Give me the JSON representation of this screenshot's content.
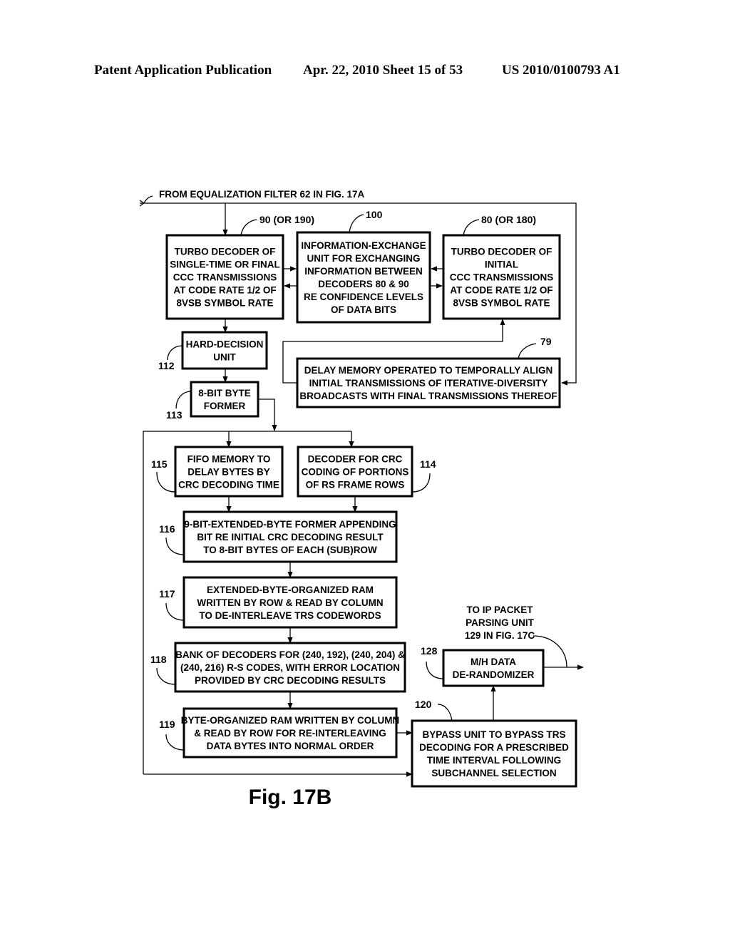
{
  "header": {
    "publication": "Patent Application Publication",
    "date_sheet": "Apr. 22, 2010  Sheet 15 of 53",
    "patent_number": "US 2010/0100793 A1"
  },
  "input_label": "FROM EQUALIZATION FILTER 62 IN FIG. 17A",
  "output_label": [
    "TO IP PACKET",
    "PARSING UNIT",
    "129 IN FIG. 17C"
  ],
  "figure_caption": "Fig. 17B",
  "blocks": {
    "b90": {
      "ref": "90 (OR 190)",
      "lines": [
        "TURBO DECODER OF",
        "SINGLE-TIME OR FINAL",
        "CCC TRANSMISSIONS",
        "AT CODE RATE 1/2 OF",
        "8VSB SYMBOL RATE"
      ]
    },
    "b100": {
      "ref": "100",
      "lines": [
        "INFORMATION-EXCHANGE",
        "UNIT FOR EXCHANGING",
        "INFORMATION BETWEEN",
        "DECODERS  80 & 90",
        "RE CONFIDENCE LEVELS",
        "OF DATA BITS"
      ]
    },
    "b80": {
      "ref": "80 (OR 180)",
      "lines": [
        "TURBO DECODER OF",
        "INITIAL",
        "CCC TRANSMISSIONS",
        "AT CODE RATE 1/2 OF",
        "8VSB SYMBOL RATE"
      ]
    },
    "b112": {
      "ref": "112",
      "lines": [
        "HARD-DECISION",
        "UNIT"
      ]
    },
    "b79": {
      "ref": "79",
      "lines": [
        "DELAY MEMORY OPERATED TO TEMPORALLY ALIGN",
        "INITIAL TRANSMISSIONS OF ITERATIVE-DIVERSITY",
        "BROADCASTS WITH FINAL TRANSMISSIONS THEREOF"
      ]
    },
    "b113": {
      "ref": "113",
      "lines": [
        "8-BIT BYTE",
        "FORMER"
      ]
    },
    "b115": {
      "ref": "115",
      "lines": [
        "FIFO MEMORY TO",
        "DELAY BYTES BY",
        "CRC DECODING TIME"
      ]
    },
    "b114": {
      "ref": "114",
      "lines": [
        "DECODER FOR CRC",
        "CODING OF PORTIONS",
        "OF RS FRAME ROWS"
      ]
    },
    "b116": {
      "ref": "116",
      "lines": [
        "9-BIT-EXTENDED-BYTE FORMER APPENDING",
        "BIT RE INITIAL CRC DECODING RESULT",
        "TO 8-BIT BYTES OF EACH (SUB)ROW"
      ]
    },
    "b117": {
      "ref": "117",
      "lines": [
        "EXTENDED-BYTE-ORGANIZED RAM",
        "WRITTEN BY ROW & READ BY COLUMN",
        "TO DE-INTERLEAVE TRS CODEWORDS"
      ]
    },
    "b118": {
      "ref": "118",
      "lines": [
        "BANK OF DECODERS FOR (240, 192), (240, 204) &",
        "(240, 216) R-S CODES, WITH ERROR LOCATION",
        "PROVIDED BY CRC DECODING RESULTS"
      ]
    },
    "b119": {
      "ref": "119",
      "lines": [
        "BYTE-ORGANIZED RAM WRITTEN BY COLUMN",
        "& READ BY ROW FOR RE-INTERLEAVING",
        "DATA BYTES INTO NORMAL ORDER"
      ]
    },
    "b120": {
      "ref": "120",
      "lines": [
        "BYPASS UNIT TO BYPASS TRS",
        "DECODING FOR A PRESCRIBED",
        "TIME INTERVAL FOLLOWING",
        "SUBCHANNEL SELECTION"
      ]
    },
    "b128": {
      "ref": "128",
      "lines": [
        "M/H DATA",
        "DE-RANDOMIZER"
      ]
    }
  }
}
